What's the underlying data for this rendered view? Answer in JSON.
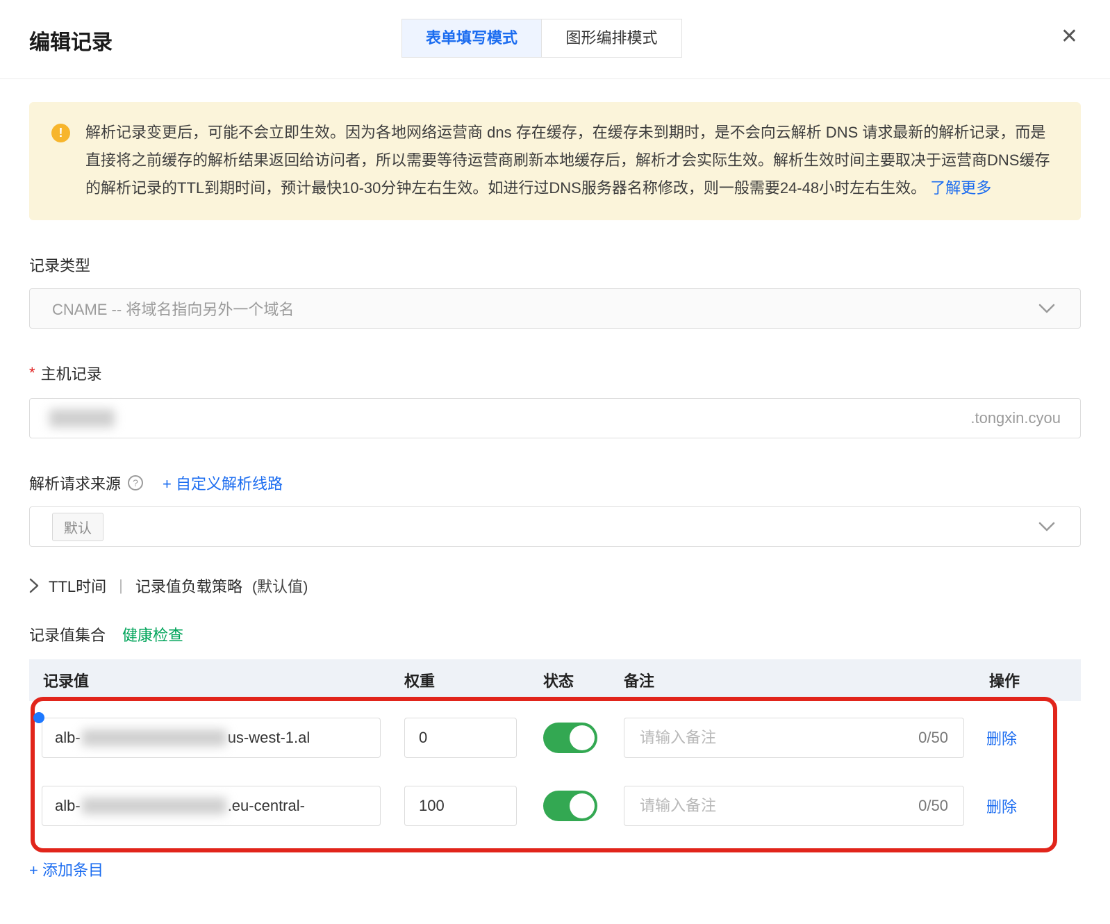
{
  "colors": {
    "accent_blue": "#1b6cf0",
    "health_green": "#00a45a",
    "toggle_green": "#33a852",
    "warning_banner_bg": "#fbf4da",
    "warning_icon": "#f7b52c",
    "annotation_red": "#e1251b",
    "annotation_dot_blue": "#1d78ff",
    "table_header_bg": "#eef2f7"
  },
  "dialog": {
    "title": "编辑记录",
    "close_icon": "✕"
  },
  "mode_tabs": [
    {
      "label": "表单填写模式",
      "active": true
    },
    {
      "label": "图形编排模式",
      "active": false
    }
  ],
  "notice": {
    "icon": "!",
    "text": "解析记录变更后，可能不会立即生效。因为各地网络运营商 dns 存在缓存，在缓存未到期时，是不会向云解析 DNS 请求最新的解析记录，而是直接将之前缓存的解析结果返回给访问者，所以需要等待运营商刷新本地缓存后，解析才会实际生效。解析生效时间主要取决于运营商DNS缓存的解析记录的TTL到期时间，预计最快10-30分钟左右生效。如进行过DNS服务器名称修改，则一般需要24-48小时左右生效。",
    "link_label": "了解更多"
  },
  "fields": {
    "record_type": {
      "label": "记录类型",
      "value": "CNAME -- 将域名指向另外一个域名"
    },
    "host_record": {
      "label": "主机记录",
      "required_mark": "*",
      "suffix": ".tongxin.cyou"
    },
    "line_source": {
      "label": "解析请求来源",
      "help_glyph": "?",
      "custom_line_link": "+ 自定义解析线路",
      "selected_tag": "默认"
    },
    "ttl": {
      "part1": "TTL时间",
      "separator": "|",
      "part2": "记录值负载策略",
      "hint": "(默认值)"
    },
    "record_set": {
      "label": "记录值集合",
      "health_check_link": "健康检查"
    }
  },
  "table": {
    "headers": {
      "value": "记录值",
      "weight": "权重",
      "status": "状态",
      "remark": "备注",
      "action": "操作"
    },
    "remark_placeholder": "请输入备注",
    "rows": [
      {
        "value_prefix": "alb-",
        "value_suffix": "us-west-1.al",
        "weight": "0",
        "status": "on",
        "remark_counter": "0/50",
        "action_label": "删除"
      },
      {
        "value_prefix": "alb-",
        "value_suffix": ".eu-central-",
        "weight": "100",
        "status": "on",
        "remark_counter": "0/50",
        "action_label": "删除"
      }
    ]
  },
  "add_entry_link": "+ 添加条目"
}
